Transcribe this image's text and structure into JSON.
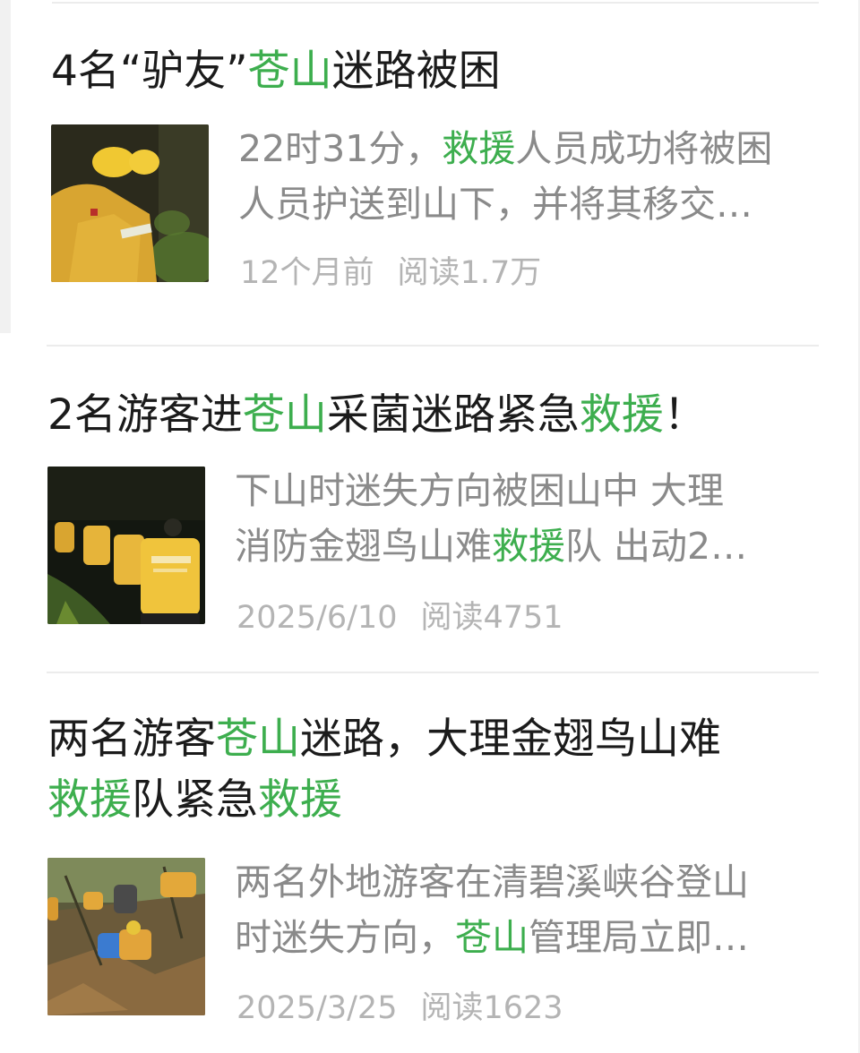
{
  "articles": [
    {
      "title": [
        {
          "text": "4名“驴友”",
          "hl": false
        },
        {
          "text": "苍山",
          "hl": true
        },
        {
          "text": "迷路被困",
          "hl": false
        }
      ],
      "summary": [
        [
          {
            "text": "22时31分，",
            "hl": false
          },
          {
            "text": "救援",
            "hl": true
          },
          {
            "text": "人员成功将被困",
            "hl": false
          }
        ],
        [
          {
            "text": "人员护送到山下，并将其移交…",
            "hl": false
          }
        ]
      ],
      "date": "12个月前",
      "reads_label": "阅读",
      "reads": "1.7万",
      "thumbnail": "rescue-team-night-forest-photo"
    },
    {
      "title": [
        {
          "text": "2名游客进",
          "hl": false
        },
        {
          "text": "苍山",
          "hl": true
        },
        {
          "text": "采菌迷路紧急",
          "hl": false
        },
        {
          "text": "救援",
          "hl": true
        },
        {
          "text": "！",
          "hl": false
        }
      ],
      "summary": [
        [
          {
            "text": "下山时迷失方向被困山中 大理",
            "hl": false
          }
        ],
        [
          {
            "text": "消防金翅鸟山难",
            "hl": false
          },
          {
            "text": "救援",
            "hl": true
          },
          {
            "text": "队 出动2…",
            "hl": false
          }
        ]
      ],
      "date": "2025/6/10",
      "reads_label": "阅读",
      "reads": "4751",
      "thumbnail": "rescuers-hiking-at-night-photo"
    },
    {
      "title": [
        {
          "text": "两名游客",
          "hl": false
        },
        {
          "text": "苍山",
          "hl": true
        },
        {
          "text": "迷路，大理金翅鸟山难",
          "hl": false
        },
        {
          "text": "救援",
          "hl": true
        },
        {
          "text": "队紧急",
          "hl": false
        },
        {
          "text": "救援",
          "hl": true
        }
      ],
      "summary": [
        [
          {
            "text": "两名外地游客在清碧溪峡谷登山",
            "hl": false
          }
        ],
        [
          {
            "text": "时迷失方向，",
            "hl": false
          },
          {
            "text": "苍山",
            "hl": true
          },
          {
            "text": "管理局立即…",
            "hl": false
          }
        ]
      ],
      "date": "2025/3/25",
      "reads_label": "阅读",
      "reads": "1623",
      "thumbnail": "rescuers-climbing-slope-photo"
    }
  ],
  "colors": {
    "highlight": "#3dae4e",
    "title": "#1b1b1b",
    "summary": "#8a8a8a",
    "meta": "#b4b4b4"
  }
}
